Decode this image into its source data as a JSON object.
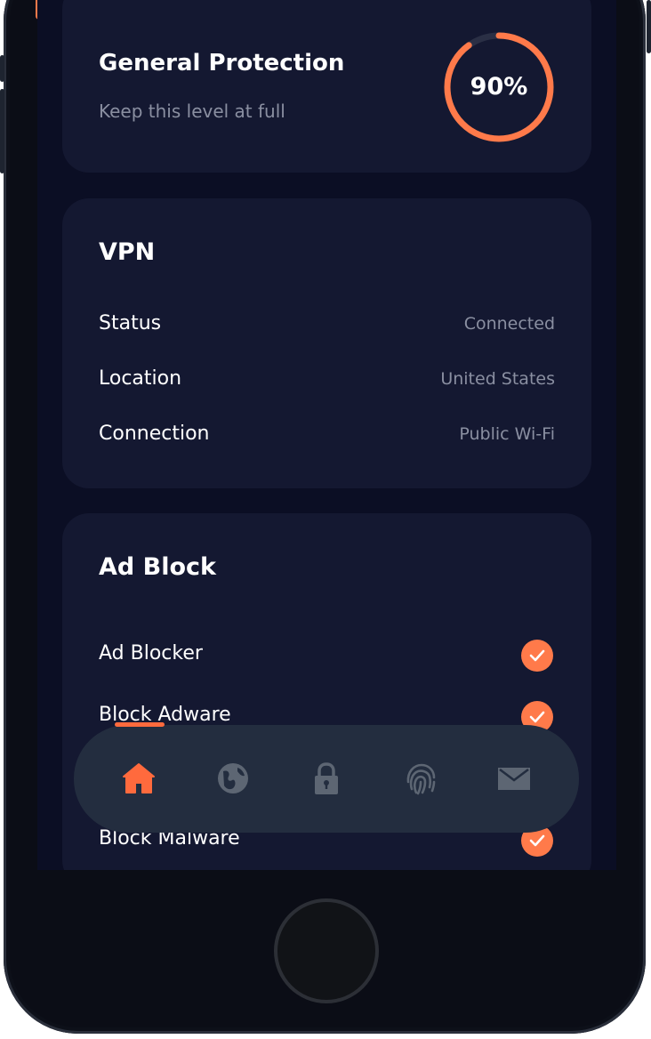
{
  "colors": {
    "accent": "#ff7a4a",
    "card": "#141831",
    "screen": "#0b0e24",
    "navbar": "#232d3f",
    "nav_icon": "#5d6673"
  },
  "general_protection": {
    "title": "General Protection",
    "subtitle": "Keep this level at full",
    "percent_label": "90%",
    "percent_value": 0.9
  },
  "vpn": {
    "title": "VPN",
    "rows": [
      {
        "label": "Status",
        "value": "Connected"
      },
      {
        "label": "Location",
        "value": "United States"
      },
      {
        "label": "Connection",
        "value": "Public Wi-Fi"
      }
    ]
  },
  "ad_block": {
    "title": "Ad Block",
    "items": [
      {
        "label": "Ad Blocker",
        "checked": true
      },
      {
        "label": "Block Adware",
        "checked": true
      },
      {
        "label": "Block Malware",
        "checked": true
      }
    ]
  },
  "navbar": {
    "items": [
      {
        "icon": "home-icon",
        "active": true
      },
      {
        "icon": "globe-icon",
        "active": false
      },
      {
        "icon": "lock-icon",
        "active": false
      },
      {
        "icon": "fingerprint-icon",
        "active": false
      },
      {
        "icon": "mail-icon",
        "active": false
      }
    ]
  }
}
